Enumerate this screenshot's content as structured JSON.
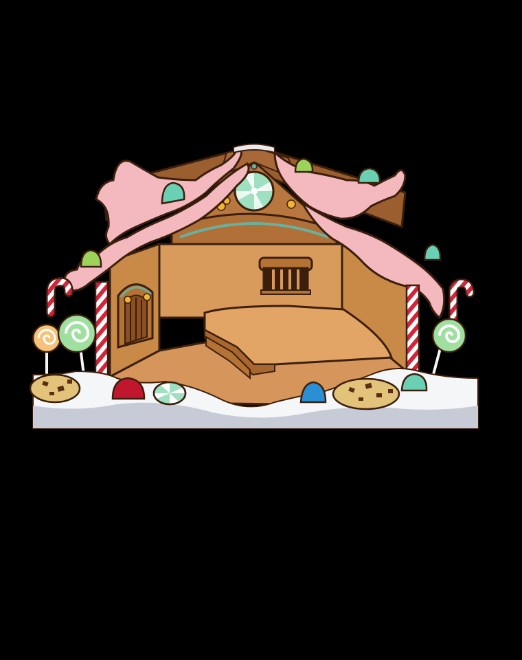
{
  "scene": {
    "name": "gingerbread-house-room",
    "background": "#000000"
  },
  "palette": {
    "icing": "#f4b8bf",
    "icing_shadow": "#e48f9e",
    "gingerbread_dark": "#9b5e2e",
    "gingerbread": "#c88a4c",
    "wall": "#d99b5b",
    "floor": "#d6955a",
    "snow": "#f4f6f8",
    "snow_shadow": "#c6cbd6",
    "candy_red": "#d3253a",
    "mint": "#9fe0c0",
    "gumdrop_teal": "#6ad0b4",
    "gumdrop_blue": "#2b8fd4",
    "gumdrop_red": "#c1172e",
    "gumdrop_green": "#9ed35a"
  },
  "icons": [
    "gingerbread-house",
    "arched-door",
    "barred-window",
    "peppermint-candy",
    "candy-cane",
    "lollipop",
    "gumdrop",
    "chocolate-chip-cookie",
    "snow-drift",
    "stage-platform"
  ]
}
